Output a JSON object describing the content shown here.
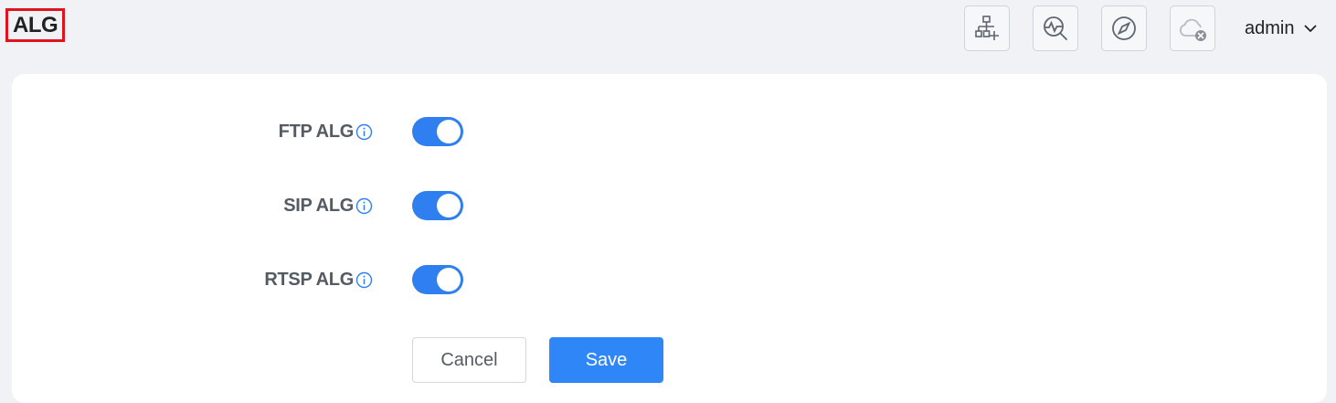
{
  "header": {
    "title": "ALG",
    "user": "admin"
  },
  "toolbar": {
    "icons": [
      "network-add-icon",
      "diagnostics-search-icon",
      "compass-icon",
      "cloud-disconnected-icon"
    ]
  },
  "settings": [
    {
      "label": "FTP ALG",
      "enabled": true
    },
    {
      "label": "SIP ALG",
      "enabled": true
    },
    {
      "label": "RTSP ALG",
      "enabled": true
    }
  ],
  "actions": {
    "cancel_label": "Cancel",
    "save_label": "Save"
  },
  "colors": {
    "accent": "#2f7ff0",
    "highlight_border": "#e0141c",
    "background": "#f1f2f6",
    "card": "#ffffff"
  }
}
